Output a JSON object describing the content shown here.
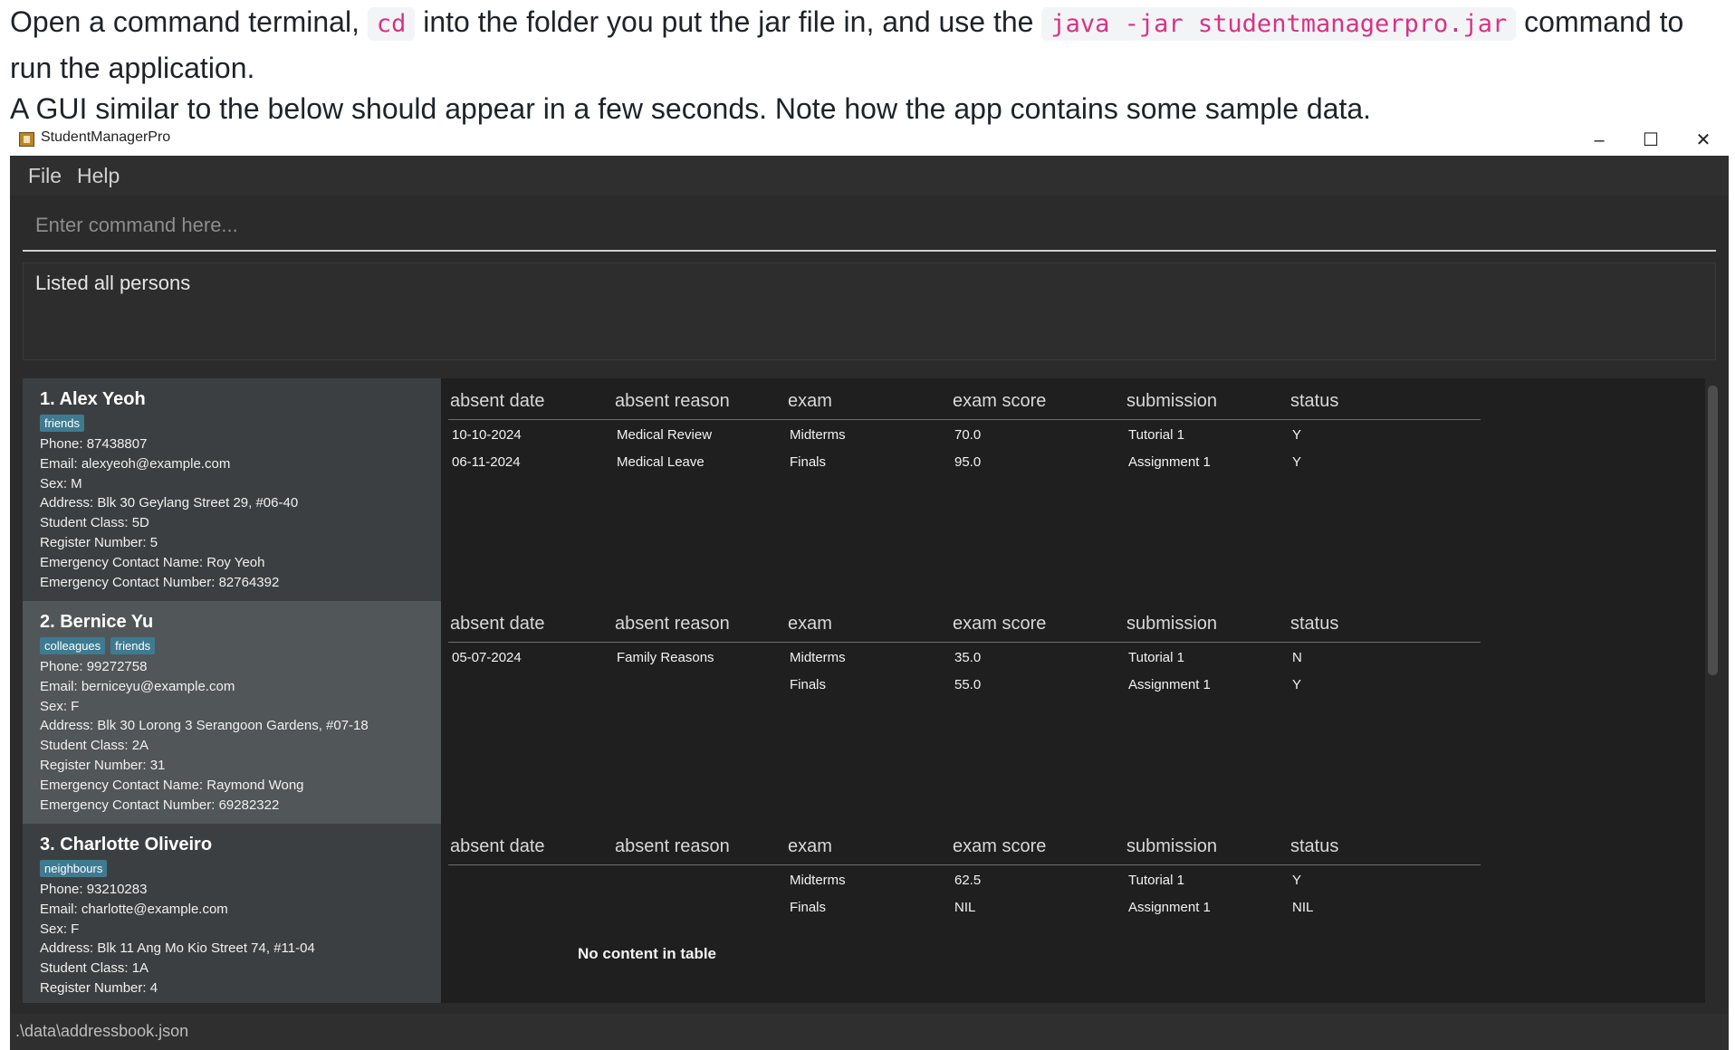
{
  "doc": {
    "line1_pre": "Open a command terminal, ",
    "cd_code": "cd",
    "line1_mid": " into the folder you put the jar file in, and use the ",
    "jar_code": "java -jar studentmanagerpro.jar",
    "line1_post": " command to run the application.",
    "line2": "A GUI similar to the below should appear in a few seconds. Note how the app contains some sample data."
  },
  "window": {
    "title": "StudentManagerPro",
    "minimize_glyph": "–",
    "maximize_glyph": "☐",
    "close_glyph": "✕"
  },
  "menu": {
    "file": "File",
    "help": "Help"
  },
  "command": {
    "placeholder": "Enter command here...",
    "value": ""
  },
  "result": {
    "text": "Listed all persons"
  },
  "headers": {
    "absent_date": "absent date",
    "absent_reason": "absent reason",
    "exam": "exam",
    "exam_score": "exam score",
    "submission": "submission",
    "status": "status"
  },
  "persons": [
    {
      "title": "1. Alex Yeoh",
      "tags": [
        "friends"
      ],
      "phone": "Phone: 87438807",
      "email": "Email: alexyeoh@example.com",
      "sex": "Sex: M",
      "address": "Address: Blk 30 Geylang Street 29, #06-40",
      "student_class": "Student Class: 5D",
      "register_number": "Register Number: 5",
      "ec_name": "Emergency Contact Name: Roy Yeoh",
      "ec_number": "Emergency Contact Number: 82764392",
      "absent_dates": [
        "10-10-2024",
        "06-11-2024"
      ],
      "absent_reasons": [
        "Medical Review",
        "Medical Leave"
      ],
      "exams": [
        "Midterms",
        "Finals"
      ],
      "exam_scores": [
        "70.0",
        "95.0"
      ],
      "submissions": [
        "Tutorial 1",
        "Assignment 1"
      ],
      "statuses": [
        "Y",
        "Y"
      ]
    },
    {
      "title": "2. Bernice Yu",
      "tags": [
        "colleagues",
        "friends"
      ],
      "phone": "Phone: 99272758",
      "email": "Email: berniceyu@example.com",
      "sex": "Sex: F",
      "address": "Address: Blk 30 Lorong 3 Serangoon Gardens, #07-18",
      "student_class": "Student Class: 2A",
      "register_number": "Register Number: 31",
      "ec_name": "Emergency Contact Name: Raymond Wong",
      "ec_number": "Emergency Contact Number: 69282322",
      "absent_dates": [
        "05-07-2024"
      ],
      "absent_reasons": [
        "Family Reasons"
      ],
      "exams": [
        "Midterms",
        "Finals"
      ],
      "exam_scores": [
        "35.0",
        "55.0"
      ],
      "submissions": [
        "Tutorial 1",
        "Assignment 1"
      ],
      "statuses": [
        "N",
        "Y"
      ]
    },
    {
      "title": "3. Charlotte Oliveiro",
      "tags": [
        "neighbours"
      ],
      "phone": "Phone: 93210283",
      "email": "Email: charlotte@example.com",
      "sex": "Sex: F",
      "address": "Address: Blk 11 Ang Mo Kio Street 74, #11-04",
      "student_class": "Student Class: 1A",
      "register_number": "Register Number: 4",
      "absent_dates": [],
      "absent_reasons": [],
      "empty_table_text": "No content in table",
      "exams": [
        "Midterms",
        "Finals"
      ],
      "exam_scores": [
        "62.5",
        "NIL"
      ],
      "submissions": [
        "Tutorial 1",
        "Assignment 1"
      ],
      "statuses": [
        "Y",
        "NIL"
      ]
    }
  ],
  "status_bar": {
    "path": ".\\data\\addressbook.json"
  }
}
